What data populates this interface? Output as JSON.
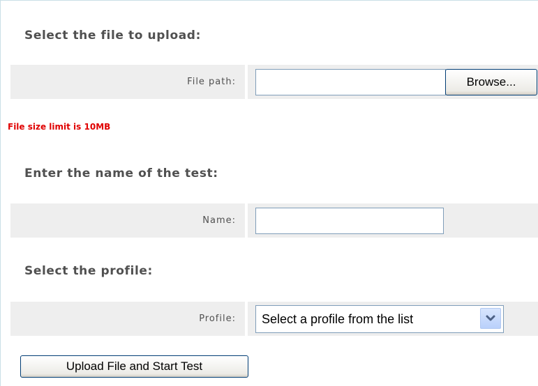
{
  "sections": {
    "file": {
      "heading": "Select the file to upload:",
      "label": "File path:",
      "value": "",
      "browse_label": "Browse..."
    },
    "limit_note": "File size limit is 10MB",
    "name": {
      "heading": "Enter the name of the test:",
      "label": "Name:",
      "value": ""
    },
    "profile": {
      "heading": "Select the profile:",
      "label": "Profile:",
      "selected": "Select a profile from the list"
    }
  },
  "submit_label": "Upload File and Start Test",
  "colors": {
    "row_bg": "#eeeeee",
    "warning": "#e00000",
    "heading": "#505050"
  },
  "icons": {
    "select_arrow": "chevron-down-icon"
  }
}
